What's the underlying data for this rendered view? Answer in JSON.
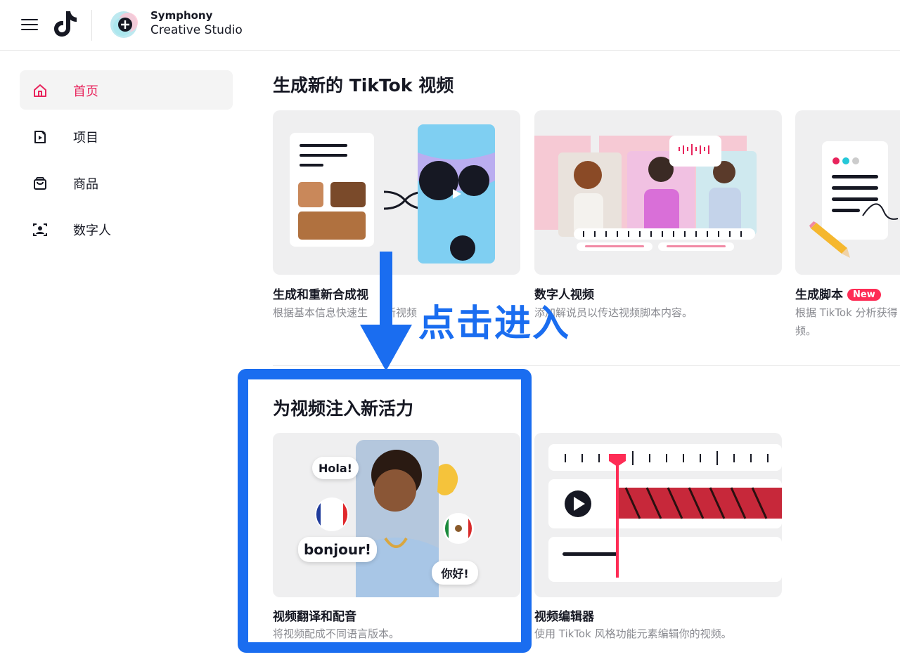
{
  "header": {
    "brand_line1": "Symphony",
    "brand_line2": "Creative Studio"
  },
  "sidebar": {
    "items": [
      {
        "label": "首页",
        "icon": "home-icon",
        "active": true
      },
      {
        "label": "项目",
        "icon": "project-icon",
        "active": false
      },
      {
        "label": "商品",
        "icon": "bag-icon",
        "active": false
      },
      {
        "label": "数字人",
        "icon": "avatar-icon",
        "active": false
      }
    ]
  },
  "section1": {
    "title": "生成新的 TikTok 视频",
    "cards": [
      {
        "title": "生成和重新合成视",
        "desc": "根据基本信息快速生",
        "desc_tail": "新视频"
      },
      {
        "title": "数字人视频",
        "desc": "添加解说员以传达视频脚本内容。"
      },
      {
        "title": "生成脚本",
        "badge": "New",
        "desc": "根据 TikTok 分析获得",
        "desc_line2": "频。"
      }
    ]
  },
  "section2": {
    "title": "为视频注入新活力",
    "cards": [
      {
        "title": "视频翻译和配音",
        "desc": "将视频配成不同语言版本。",
        "bubbles": {
          "hola": "Hola!",
          "bonjour": "bonjour!",
          "nihao": "你好!"
        }
      },
      {
        "title": "视频编辑器",
        "desc": "使用 TikTok 风格功能元素编辑你的视频。"
      }
    ]
  },
  "annotation": {
    "text": "点击进入",
    "color": "#1a6df0"
  },
  "colors": {
    "accent": "#e8245c",
    "badge": "#fe2c55"
  }
}
